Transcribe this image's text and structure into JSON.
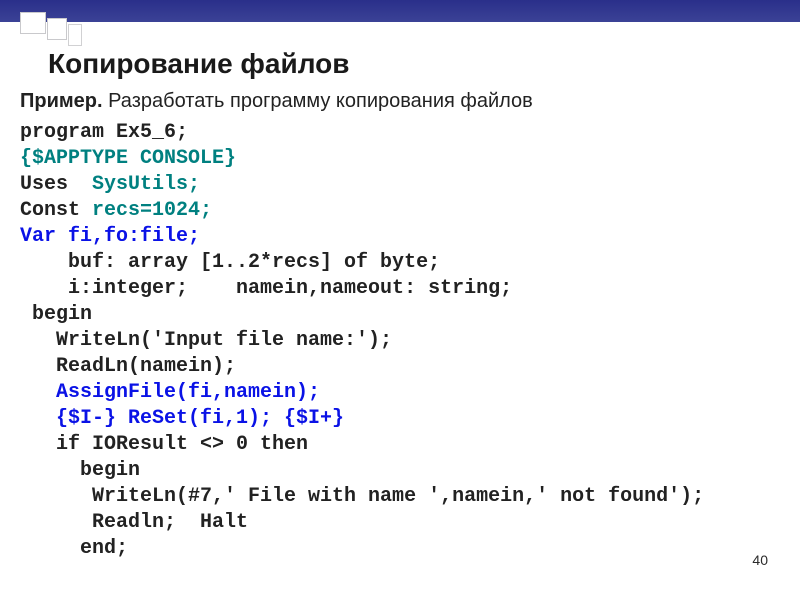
{
  "slide": {
    "title": "Копирование файлов",
    "subtitle_bold": "Пример.",
    "subtitle_rest": " Разработать программу копирования файлов",
    "page_number": "40"
  },
  "code": {
    "l1": "program Ex5_6;",
    "l2": "{$APPTYPE CONSOLE}",
    "l3a": "Uses  ",
    "l3b": "SysUtils;",
    "l4a": "Const ",
    "l4b": "recs=1024;",
    "l5": "Var fi,fo:file;",
    "l6": "    buf: array [1..2*recs] of byte;",
    "l7": "    i:integer;    namein,nameout: string;",
    "l8": " begin",
    "l9": "   WriteLn('Input file name:');",
    "l10": "   ReadLn(namein);",
    "l11": "   AssignFile(fi,namein);",
    "l12": "   {$I-} ReSet(fi,1); {$I+}",
    "l13": "   if IOResult <> 0 then",
    "l14": "     begin",
    "l15": "      WriteLn(#7,' File with name ',namein,' not found');",
    "l16": "      Readln;  Halt",
    "l17": "     end;"
  }
}
